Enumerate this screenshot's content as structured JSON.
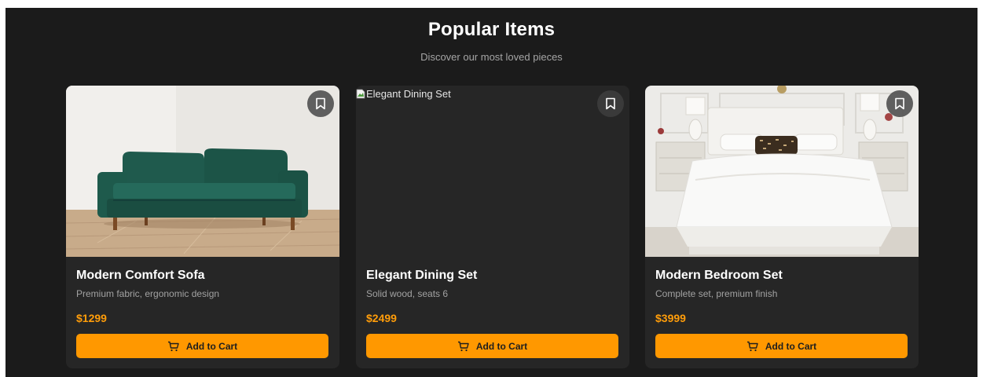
{
  "section": {
    "title": "Popular Items",
    "subtitle": "Discover our most loved pieces"
  },
  "products": [
    {
      "name": "Modern Comfort Sofa",
      "description": "Premium fabric, ergonomic design",
      "price": "$1299",
      "button_label": "Add to Cart",
      "image": "green velvet sofa on light wood floor",
      "image_alt": "Modern Comfort Sofa"
    },
    {
      "name": "Elegant Dining Set",
      "description": "Solid wood, seats 6",
      "price": "$2499",
      "button_label": "Add to Cart",
      "image": "broken image",
      "image_alt": "Elegant Dining Set"
    },
    {
      "name": "Modern Bedroom Set",
      "description": "Complete set, premium finish",
      "price": "$3999",
      "button_label": "Add to Cart",
      "image": "white upholstered bed with lamps and nightstands",
      "image_alt": "Modern Bedroom Set"
    }
  ],
  "icons": {
    "bookmark": "bookmark-icon",
    "cart": "cart-icon",
    "broken_image": "broken-image-icon"
  },
  "colors": {
    "background": "#1b1b1b",
    "card": "#262626",
    "accent": "#ff9800",
    "price": "#ff9d0a"
  }
}
